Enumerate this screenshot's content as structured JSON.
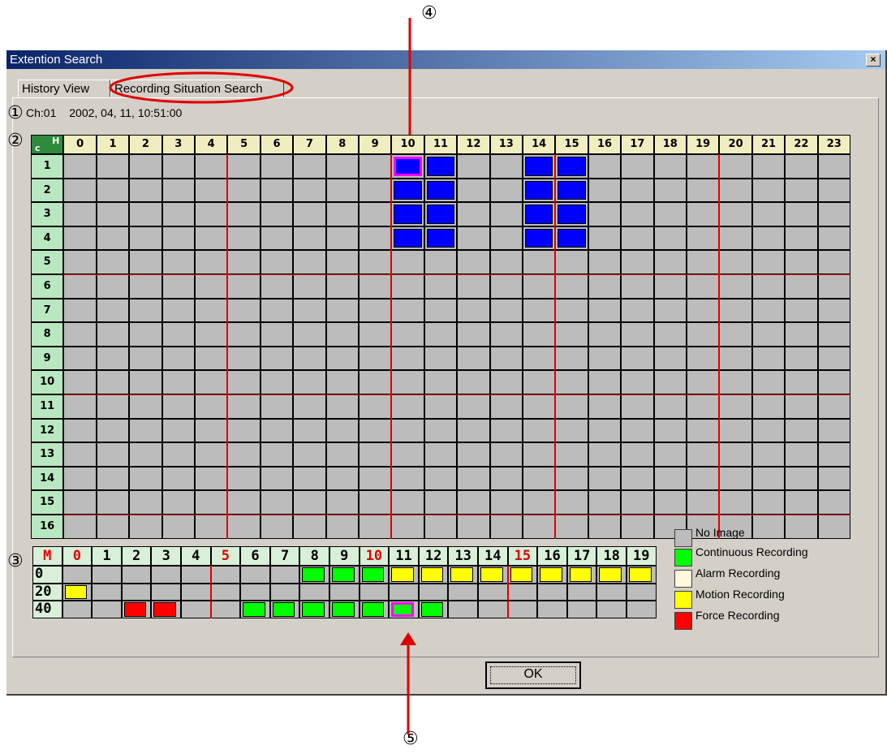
{
  "window": {
    "title": "Extention Search",
    "close_label": "×"
  },
  "tabs": [
    {
      "label": "History View",
      "active": false
    },
    {
      "label": "Recording Situation Search",
      "active": true
    }
  ],
  "info": {
    "channel": "Ch:01",
    "datetime": "2002, 04, 11, 10:51:00"
  },
  "callouts": {
    "c1": "①",
    "c2": "②",
    "c3": "③",
    "c4": "④",
    "c5": "⑤"
  },
  "hour_grid": {
    "corner_top": "H",
    "corner_bottom": "c",
    "hours": [
      "0",
      "1",
      "2",
      "3",
      "4",
      "5",
      "6",
      "7",
      "8",
      "9",
      "10",
      "11",
      "12",
      "13",
      "14",
      "15",
      "16",
      "17",
      "18",
      "19",
      "20",
      "21",
      "22",
      "23"
    ],
    "channels": [
      "1",
      "2",
      "3",
      "4",
      "5",
      "6",
      "7",
      "8",
      "9",
      "10",
      "11",
      "12",
      "13",
      "14",
      "15",
      "16"
    ],
    "recorded": [
      {
        "channel": 1,
        "hours": [
          10,
          11,
          14,
          15
        ],
        "selected_hour": 10
      },
      {
        "channel": 2,
        "hours": [
          10,
          11,
          14,
          15
        ]
      },
      {
        "channel": 3,
        "hours": [
          10,
          11,
          14,
          15
        ]
      },
      {
        "channel": 4,
        "hours": [
          10,
          11,
          14,
          15
        ]
      }
    ],
    "colors": {
      "recorded": "#0000ff",
      "selected_border": "#ff00ff",
      "empty": "#bcbcbc"
    }
  },
  "minute_grid": {
    "corner": "M",
    "columns": [
      "0",
      "1",
      "2",
      "3",
      "4",
      "5",
      "6",
      "7",
      "8",
      "9",
      "10",
      "11",
      "12",
      "13",
      "14",
      "15",
      "16",
      "17",
      "18",
      "19"
    ],
    "red_columns": [
      "0",
      "5",
      "10",
      "15"
    ],
    "rows": [
      "0",
      "20",
      "40"
    ],
    "cells": [
      {
        "row": 0,
        "col": 8,
        "type": "continuous"
      },
      {
        "row": 0,
        "col": 9,
        "type": "continuous"
      },
      {
        "row": 0,
        "col": 10,
        "type": "continuous"
      },
      {
        "row": 0,
        "col": 11,
        "type": "motion"
      },
      {
        "row": 0,
        "col": 12,
        "type": "motion"
      },
      {
        "row": 0,
        "col": 13,
        "type": "motion"
      },
      {
        "row": 0,
        "col": 14,
        "type": "motion"
      },
      {
        "row": 0,
        "col": 15,
        "type": "motion"
      },
      {
        "row": 0,
        "col": 16,
        "type": "motion"
      },
      {
        "row": 0,
        "col": 17,
        "type": "motion"
      },
      {
        "row": 0,
        "col": 18,
        "type": "motion"
      },
      {
        "row": 0,
        "col": 19,
        "type": "motion"
      },
      {
        "row": 1,
        "col": 0,
        "type": "motion"
      },
      {
        "row": 2,
        "col": 2,
        "type": "force"
      },
      {
        "row": 2,
        "col": 3,
        "type": "force"
      },
      {
        "row": 2,
        "col": 6,
        "type": "continuous"
      },
      {
        "row": 2,
        "col": 7,
        "type": "continuous"
      },
      {
        "row": 2,
        "col": 8,
        "type": "continuous"
      },
      {
        "row": 2,
        "col": 9,
        "type": "continuous"
      },
      {
        "row": 2,
        "col": 10,
        "type": "continuous"
      },
      {
        "row": 2,
        "col": 11,
        "type": "continuous",
        "selected": true
      },
      {
        "row": 2,
        "col": 12,
        "type": "continuous"
      }
    ]
  },
  "legend": [
    {
      "type": "none",
      "label": "No Image",
      "color": "#bcbcbc"
    },
    {
      "type": "continuous",
      "label": "Continuous Recording",
      "color": "#00ff00"
    },
    {
      "type": "alarm",
      "label": "Alarm Recording",
      "color": "#fff8dc"
    },
    {
      "type": "motion",
      "label": "Motion Recording",
      "color": "#ffff00"
    },
    {
      "type": "force",
      "label": "Force Recording",
      "color": "#ff0000"
    }
  ],
  "buttons": {
    "ok": "OK"
  },
  "annotation_color": "#e00000"
}
